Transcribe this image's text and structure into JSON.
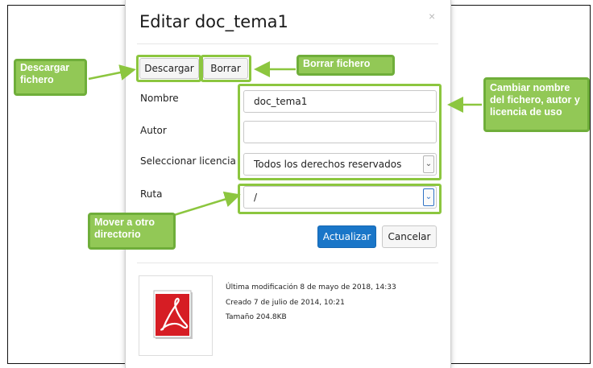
{
  "dialog": {
    "title": "Editar doc_tema1",
    "close_glyph": "×",
    "download_label": "Descargar",
    "delete_label": "Borrar",
    "fields": {
      "name_label": "Nombre",
      "name_value": "doc_tema1",
      "author_label": "Autor",
      "author_value": "",
      "license_label": "Seleccionar licencia",
      "license_value": "Todos los derechos reservados",
      "path_label": "Ruta",
      "path_value": "/"
    },
    "update_label": "Actualizar",
    "cancel_label": "Cancelar",
    "meta": {
      "modified": "Última modificación  8 de mayo de 2018, 14:33",
      "created": "Creado  7 de julio de 2014, 10:21",
      "size": "Tamaño  204.8KB"
    }
  },
  "callouts": {
    "download": "Descargar fichero",
    "delete": "Borrar fichero",
    "rename": "Cambiar nombre del fichero, autor y licencia de uso",
    "move": "Mover a otro directorio"
  },
  "colors": {
    "callout_fill": "#92c856",
    "callout_border": "#6fae3a",
    "primary_button": "#1a76c8"
  },
  "icons": {
    "close": "close-icon",
    "file": "pdf-file-icon",
    "select_caret": "chevron-down-icon"
  }
}
